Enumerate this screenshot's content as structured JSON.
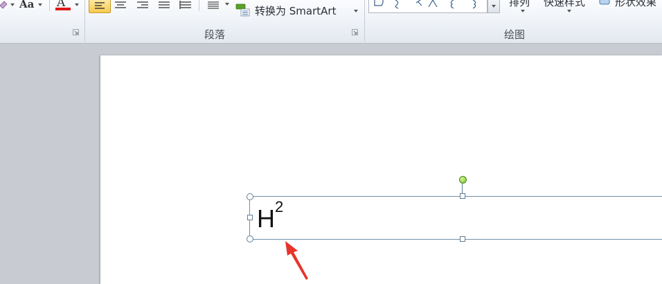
{
  "ribbon": {
    "font_group": {
      "change_case_label": "Aa",
      "font_color_label": "A",
      "font_color": "#e01818"
    },
    "paragraph_group": {
      "label": "段落",
      "convert_smartart_label": "转换为 SmartArt"
    },
    "drawing_group": {
      "label": "绘图",
      "cut_label_1": "排列",
      "cut_label_2": "快速样式",
      "cut_label_3": "形状效果"
    }
  },
  "document": {
    "textbox": {
      "base_text": "H",
      "superscript_text": "2"
    },
    "annotation_arrow_color": "#e8332a",
    "rotation_handle_color": "#78c02a"
  }
}
